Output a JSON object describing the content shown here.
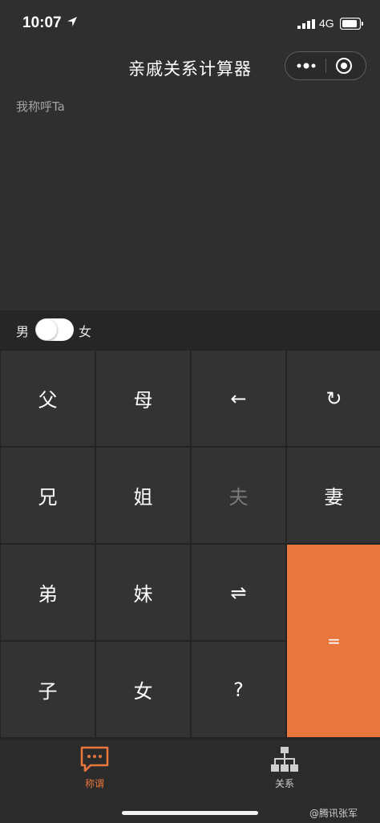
{
  "status_bar": {
    "time": "10:07",
    "network": "4G"
  },
  "nav": {
    "title": "亲戚关系计算器"
  },
  "display": {
    "label": "我称呼Ta"
  },
  "gender": {
    "male_label": "男",
    "female_label": "女"
  },
  "keypad": {
    "keys": [
      "父",
      "母",
      "←",
      "↻",
      "兄",
      "姐",
      "夫",
      "妻",
      "弟",
      "妹",
      "⇌",
      "=",
      "子",
      "女",
      "?"
    ]
  },
  "tabbar": {
    "tabs": [
      {
        "label": "称谓",
        "active": true,
        "color": "#e8773d"
      },
      {
        "label": "关系",
        "active": false,
        "color": "#cfcfcf"
      }
    ]
  },
  "watermark": "@腾讯张军"
}
